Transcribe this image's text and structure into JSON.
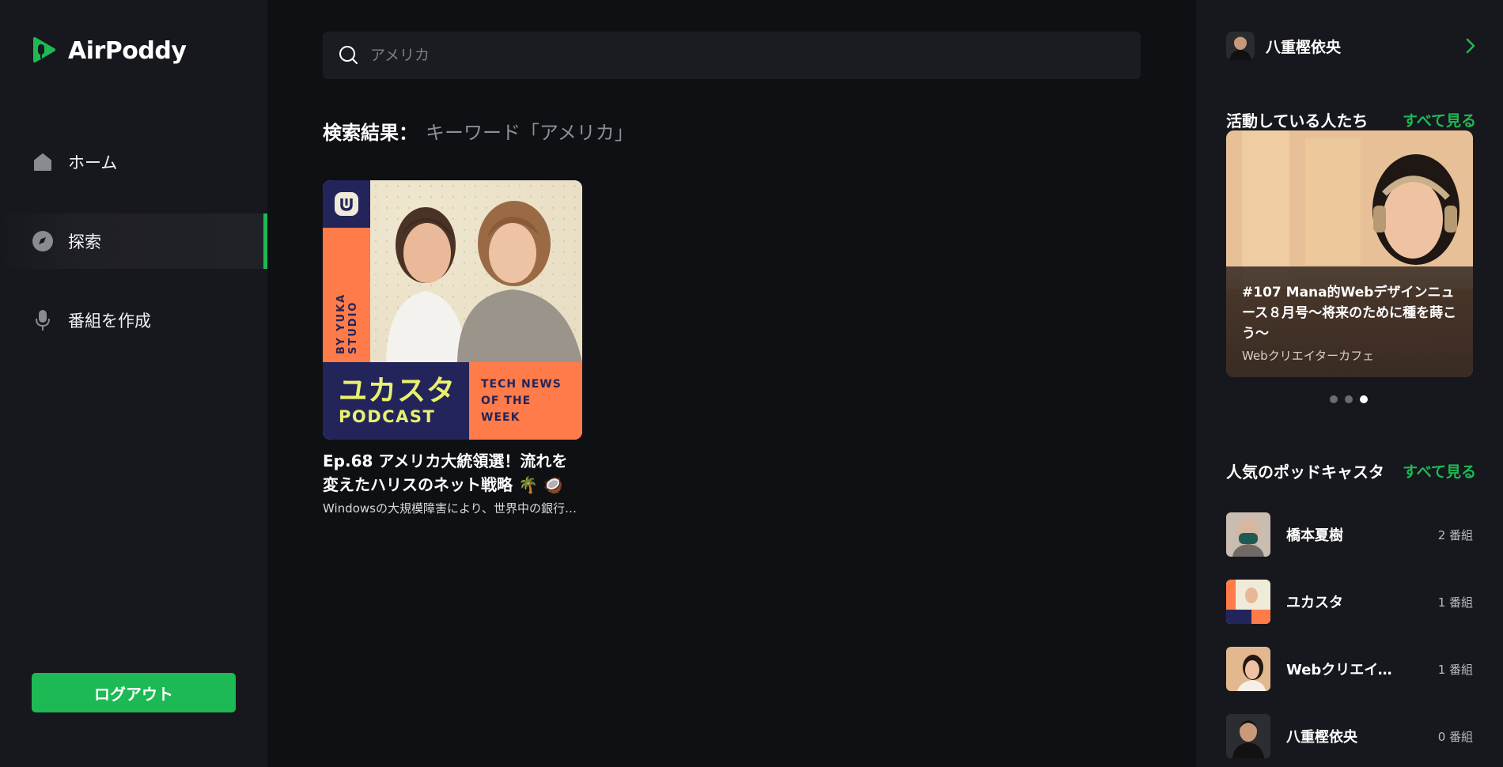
{
  "app": {
    "name": "AirPoddy",
    "accent": "#1db954"
  },
  "sidebar": {
    "items": [
      {
        "label": "ホーム",
        "icon": "home-icon"
      },
      {
        "label": "探索",
        "icon": "compass-icon",
        "active": true
      },
      {
        "label": "番組を作成",
        "icon": "microphone-icon"
      }
    ],
    "logout_label": "ログアウト"
  },
  "search": {
    "placeholder": "アメリカ"
  },
  "results": {
    "label": "検索結果：",
    "keyword": "キーワード「アメリカ」",
    "items": [
      {
        "title": "Ep.68 アメリカ大統領選！流れを変えたハリスのネット戦略 🌴 🥥",
        "description": "Windowsの大規模障害により、世界中の銀行…",
        "cover": {
          "vertical_text": "BY YUKA STUDIO",
          "title_big": "ユカスタ",
          "title_small": "PODCAST",
          "tag_lines": [
            "TECH NEWS",
            "OF THE",
            "WEEK"
          ]
        }
      }
    ]
  },
  "right_panel": {
    "user": {
      "name": "八重樫依央"
    },
    "active_people": {
      "title": "活動している人たち",
      "see_all": "すべて見る",
      "featured": {
        "title": "#107 Mana的Webデザインニュース８月号〜将来のために種を蒔こう〜",
        "subtitle": "Webクリエイターカフェ"
      },
      "carousel": {
        "count": 3,
        "active_index": 2
      }
    },
    "popular": {
      "title": "人気のポッドキャスタ",
      "see_all": "すべて見る",
      "items": [
        {
          "name": "橋本夏樹",
          "count": "2 番組"
        },
        {
          "name": "ユカスタ",
          "count": "1 番組"
        },
        {
          "name": "Webクリエイターカフェ",
          "count": "1 番組"
        },
        {
          "name": "八重樫依央",
          "count": "0 番組"
        }
      ]
    }
  }
}
